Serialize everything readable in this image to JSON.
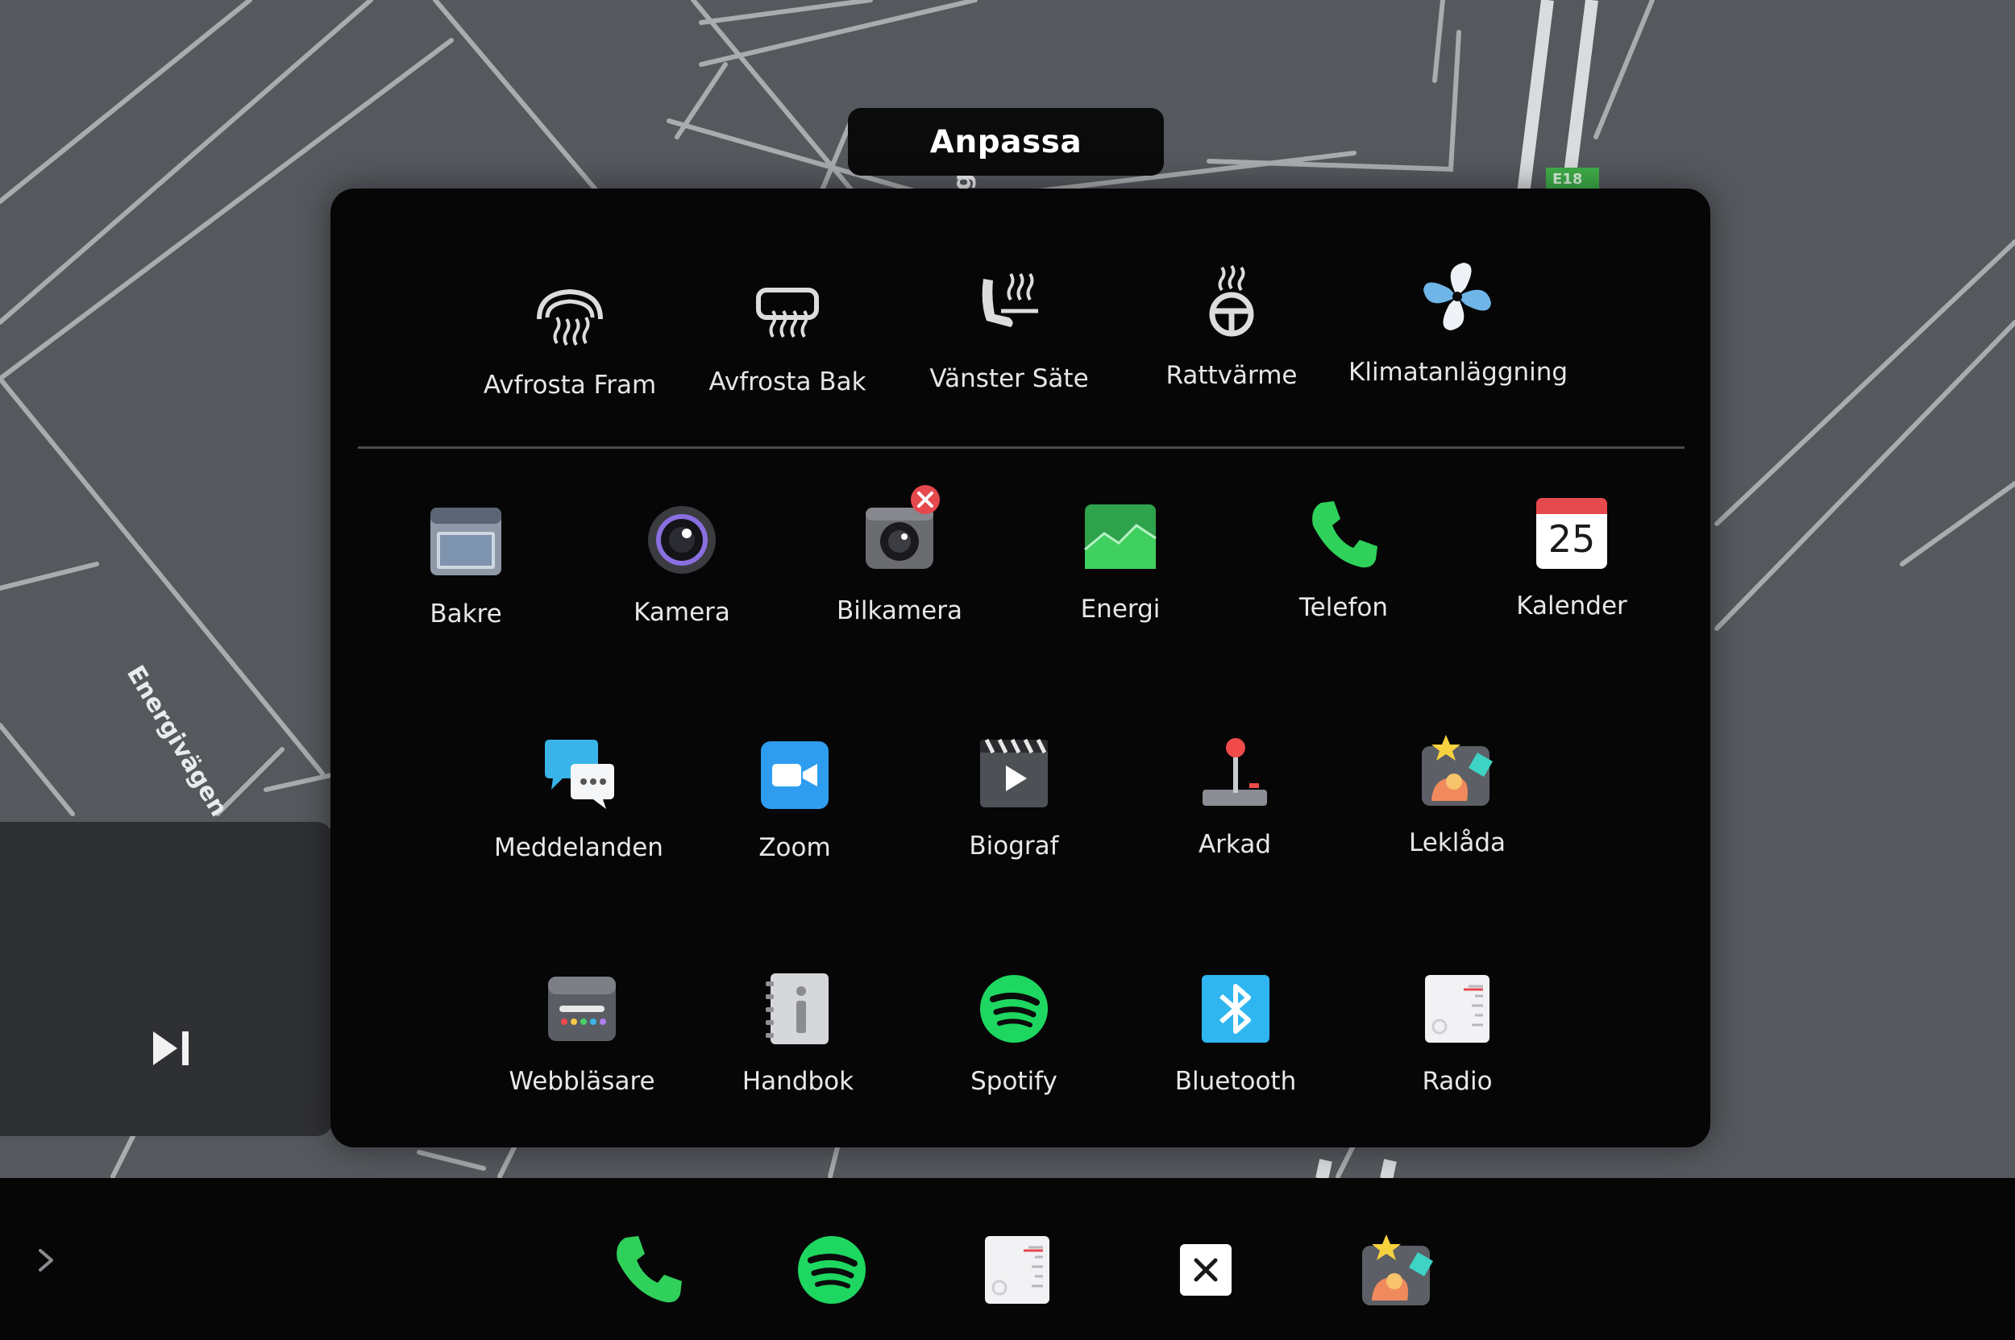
{
  "overlay_title": "Anpassa",
  "map": {
    "street_label": "Energivägen",
    "partial_label": "g",
    "road_badge": "E18",
    "road_badge_color": "#3fae49"
  },
  "quick_controls": [
    {
      "icon": "front-defrost-icon",
      "label": "Avfrosta Fram"
    },
    {
      "icon": "rear-defrost-icon",
      "label": "Avfrosta Bak"
    },
    {
      "icon": "seat-heater-icon",
      "label": "Vänster Säte"
    },
    {
      "icon": "steering-wheel-heat-icon",
      "label": "Rattvärme"
    },
    {
      "icon": "fan-icon",
      "label": "Klimatanläggning"
    }
  ],
  "apps_row1": [
    {
      "icon": "rear-view-icon",
      "label": "Bakre"
    },
    {
      "icon": "camera-icon",
      "label": "Kamera"
    },
    {
      "icon": "dashcam-icon",
      "label": "Bilkamera",
      "removable": true
    },
    {
      "icon": "energy-icon",
      "label": "Energi"
    },
    {
      "icon": "phone-icon",
      "label": "Telefon"
    },
    {
      "icon": "calendar-icon",
      "label": "Kalender",
      "day": "25"
    }
  ],
  "apps_row2": [
    {
      "icon": "messages-icon",
      "label": "Meddelanden"
    },
    {
      "icon": "zoom-icon",
      "label": "Zoom"
    },
    {
      "icon": "theater-icon",
      "label": "Biograf"
    },
    {
      "icon": "arcade-icon",
      "label": "Arkad"
    },
    {
      "icon": "toybox-icon",
      "label": "Leklåda"
    }
  ],
  "apps_row3": [
    {
      "icon": "browser-icon",
      "label": "Webbläsare"
    },
    {
      "icon": "manual-icon",
      "label": "Handbok"
    },
    {
      "icon": "spotify-icon",
      "label": "Spotify"
    },
    {
      "icon": "bluetooth-icon",
      "label": "Bluetooth"
    },
    {
      "icon": "radio-icon",
      "label": "Radio"
    }
  ],
  "dock": [
    {
      "icon": "phone-icon"
    },
    {
      "icon": "spotify-icon"
    },
    {
      "icon": "radio-icon"
    },
    {
      "icon": "close-icon"
    },
    {
      "icon": "toybox-icon"
    }
  ],
  "colors": {
    "accent_green": "#2fd15a",
    "spotify_green": "#1ed760",
    "remove_badge": "#e5484d",
    "bluetooth_blue": "#2fb6f0",
    "panel_bg": "#060607",
    "map_bg": "#55585d"
  }
}
